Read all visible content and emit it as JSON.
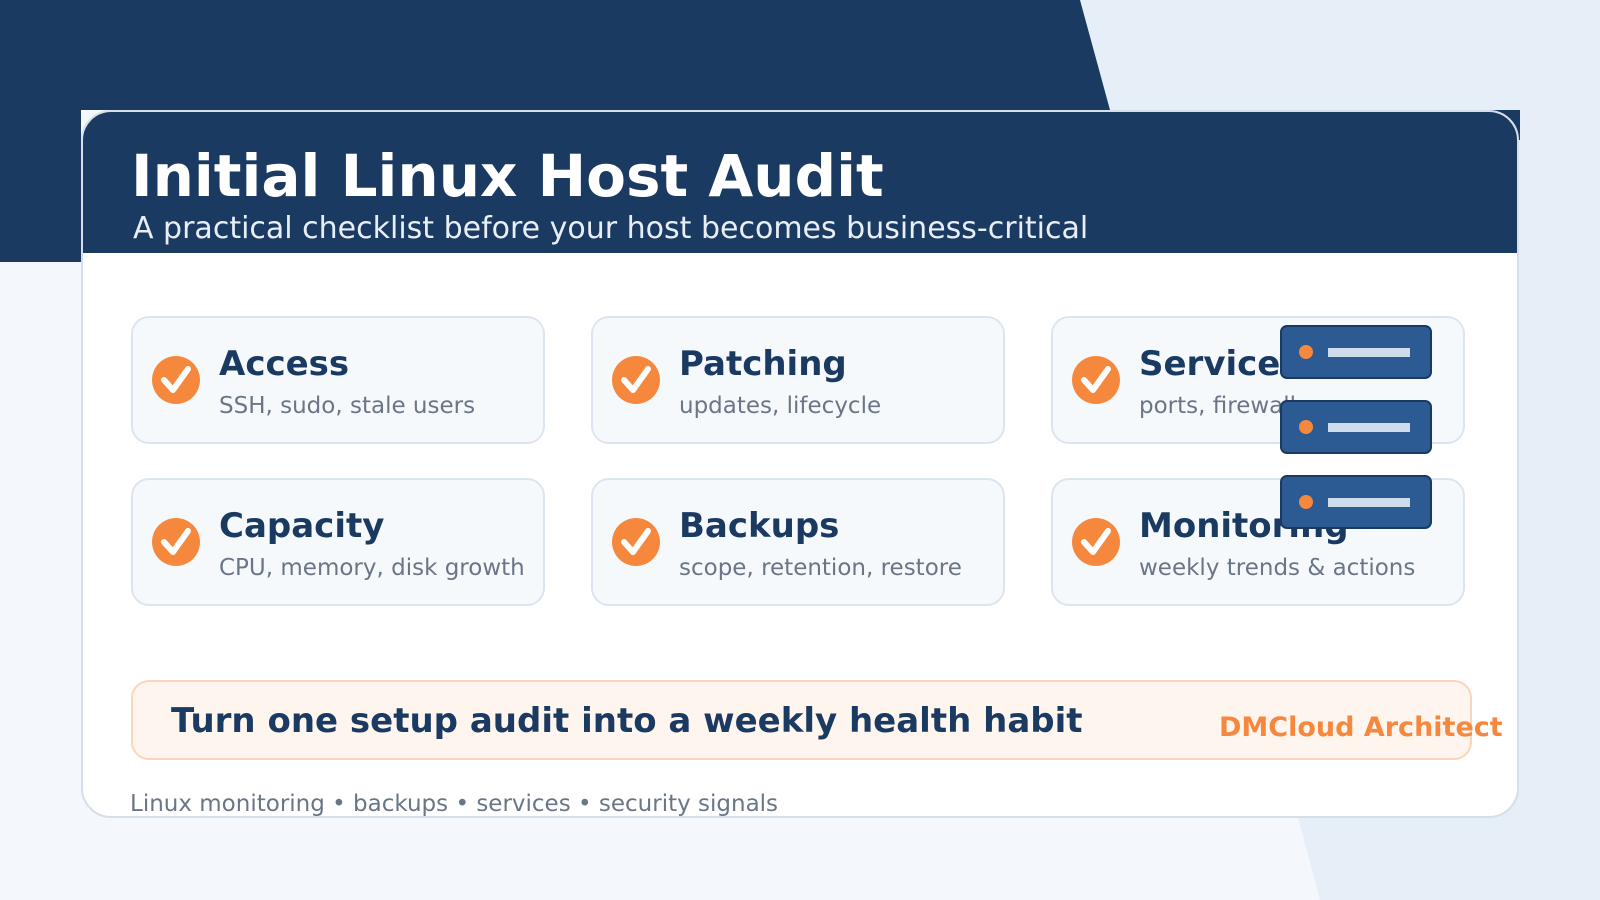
{
  "header": {
    "title": "Initial Linux Host Audit",
    "subtitle": "A practical checklist before your host becomes business-critical"
  },
  "checklist": [
    {
      "title": "Access",
      "subtitle": "SSH, sudo, stale users",
      "icon": "check-circle-icon"
    },
    {
      "title": "Patching",
      "subtitle": "updates, lifecycle",
      "icon": "check-circle-icon"
    },
    {
      "title": "Services",
      "subtitle": "ports, firewall",
      "icon": "check-circle-icon"
    },
    {
      "title": "Capacity",
      "subtitle": "CPU, memory, disk growth",
      "icon": "check-circle-icon"
    },
    {
      "title": "Backups",
      "subtitle": "scope, retention, restore",
      "icon": "check-circle-icon"
    },
    {
      "title": "Monitoring",
      "subtitle": "weekly trends & actions",
      "icon": "check-circle-icon"
    }
  ],
  "banner": {
    "text": "Turn one setup audit into a weekly health habit"
  },
  "brand": "DMCloud Architect",
  "footer": "Linux monitoring • backups • services • security signals",
  "decoration": {
    "server_icon": "server-rack-icon"
  },
  "colors": {
    "navy": "#1b3a62",
    "accent_orange": "#f5883d",
    "background": "#f4f7fb",
    "server_blue": "#2c5b94"
  }
}
